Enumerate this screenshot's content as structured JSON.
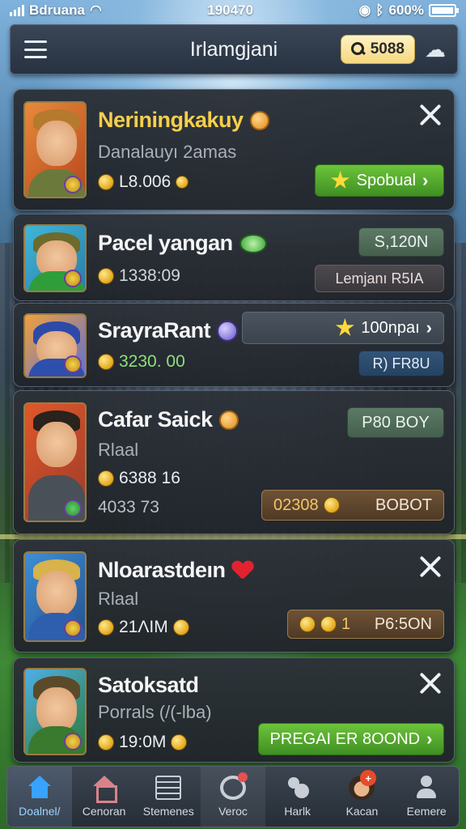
{
  "status_bar": {
    "carrier": "Bdruana",
    "time": "190470",
    "battery": "600%",
    "battery_level": 1.0
  },
  "header": {
    "title": "Irlamgjani",
    "search_value": "5088"
  },
  "cards": [
    {
      "name": "Neriningkakuy",
      "subtitle": "Danalauyı 2amas",
      "coins": "L8.006",
      "button_label": "Spobual",
      "accent": "#f7cf4a"
    },
    {
      "name": "Pacel yangan",
      "coins": "1338:09",
      "top_button": "S,120N",
      "bottom_button": "Lemjanı⁠⁠ R5IA"
    },
    {
      "name": "SrayraRant",
      "coins": "3230. 00",
      "top_button": "100npaı",
      "bottom_button": "R) FR8U"
    },
    {
      "name": "Cafar Saick",
      "subtitle": "Rlaal",
      "coins": "6388 16",
      "extra": "4033 73",
      "top_button": "P80 BOY",
      "bottom_left": "02308",
      "bottom_right": "BOBOT"
    },
    {
      "name": "Nloarastdeın",
      "subtitle": "Rlaal",
      "coins": "21ΛΙΜ",
      "button_left": "1",
      "button_right": "P6:5ON"
    },
    {
      "name": "Satoksatd",
      "subtitle": "Porrals (/(-lba)",
      "coins": "19:0M",
      "button_label": "PREGAI ER 8OOND"
    }
  ],
  "nav": [
    {
      "label": "Doalnel/",
      "icon": "home-icon"
    },
    {
      "label": "Cenoran",
      "icon": "shop-icon"
    },
    {
      "label": "Stemenes",
      "icon": "list-icon"
    },
    {
      "label": "Veroc",
      "icon": "target-icon"
    },
    {
      "label": "Harlk",
      "icon": "people-icon"
    },
    {
      "label": "Kacan",
      "icon": "avatar-icon",
      "badge": "+"
    },
    {
      "label": "Eemere",
      "icon": "profile-icon"
    }
  ]
}
